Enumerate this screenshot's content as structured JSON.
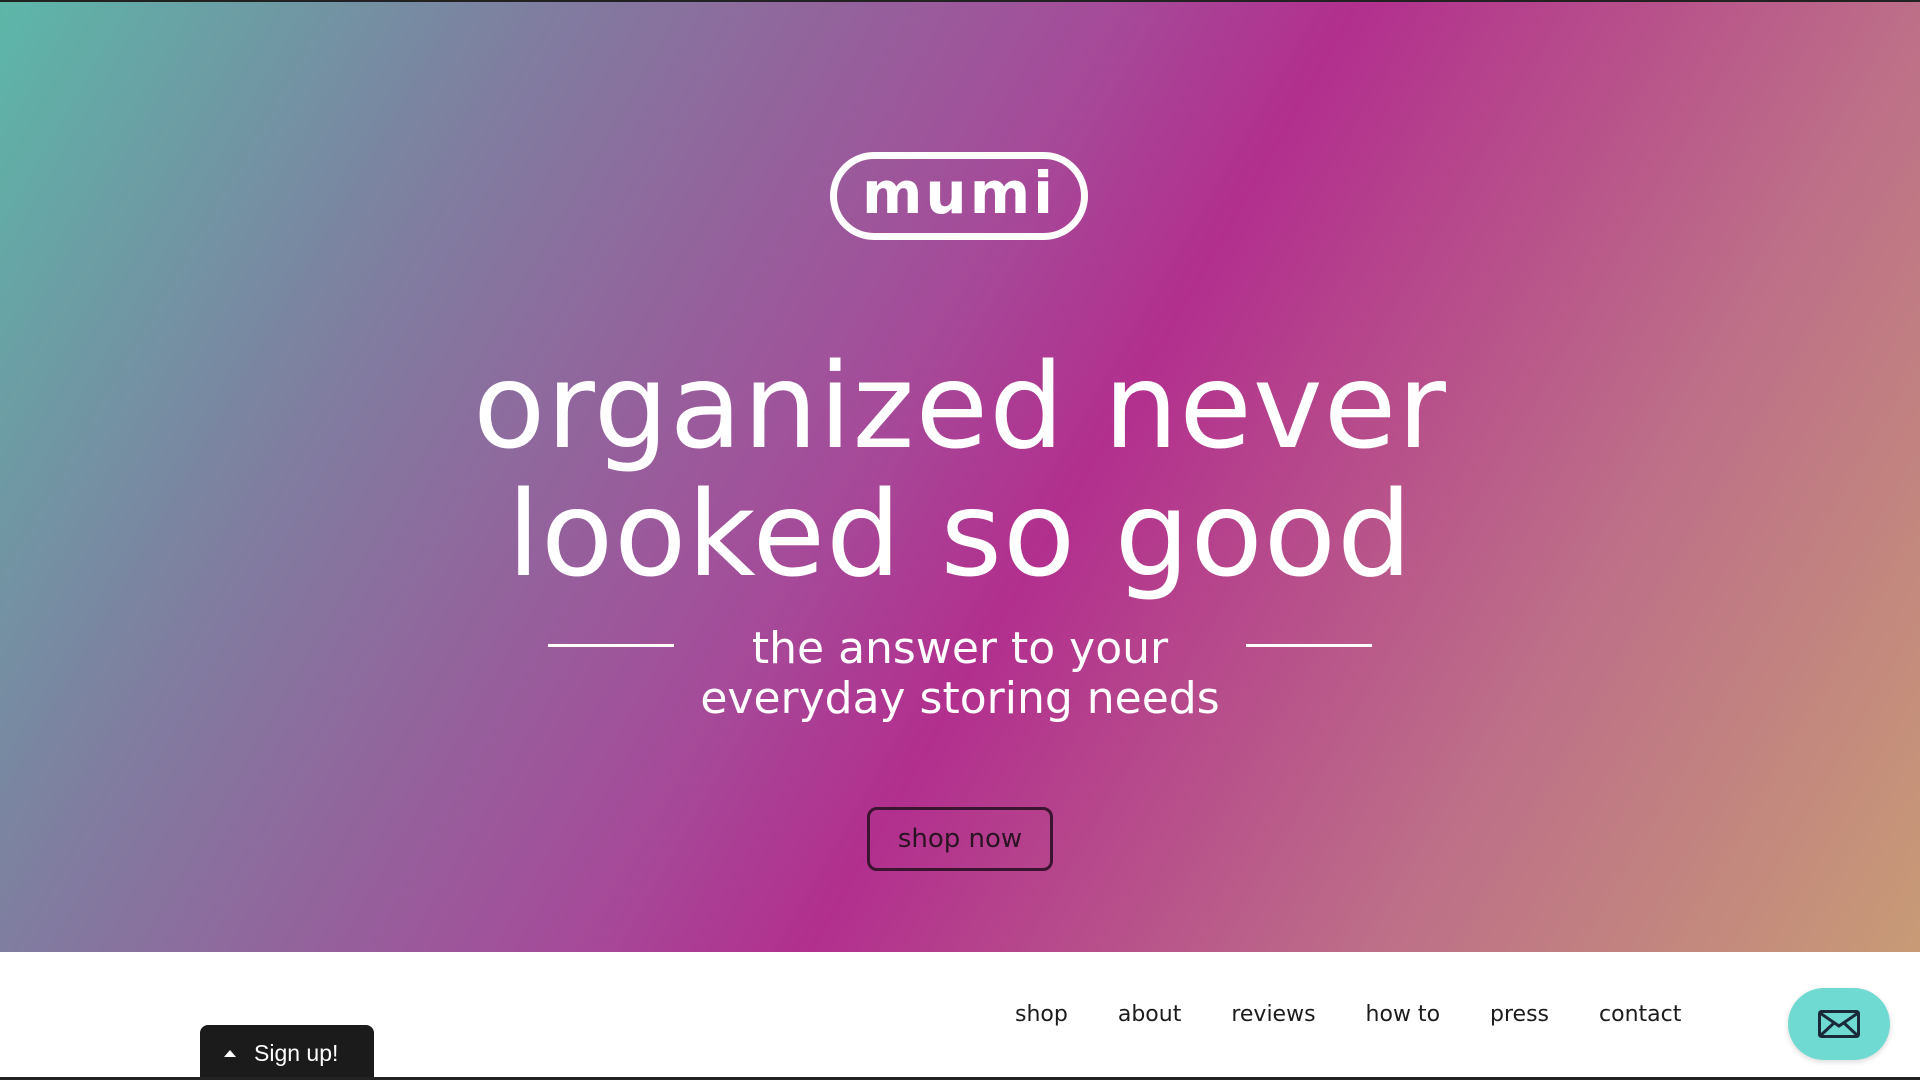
{
  "logo": {
    "text": "mumi"
  },
  "hero": {
    "headline_line1": "organized never",
    "headline_line2": "looked so good",
    "subtitle_line1": "the answer to your",
    "subtitle_line2": "everyday storing needs",
    "cta_label": "shop now"
  },
  "nav": {
    "items": [
      {
        "label": "shop"
      },
      {
        "label": "about"
      },
      {
        "label": "reviews"
      },
      {
        "label": "how to"
      },
      {
        "label": "press"
      },
      {
        "label": "contact"
      }
    ]
  },
  "signup": {
    "label": "Sign up!",
    "icon": "caret-up-icon"
  },
  "mail_widget": {
    "icon": "envelope-icon"
  },
  "colors": {
    "gradient_start": "#5cb7a8",
    "gradient_mid": "#b22f8e",
    "gradient_end": "#c89b76",
    "mail_button": "#6fdad2",
    "signup_bg": "#1b1b1b"
  }
}
